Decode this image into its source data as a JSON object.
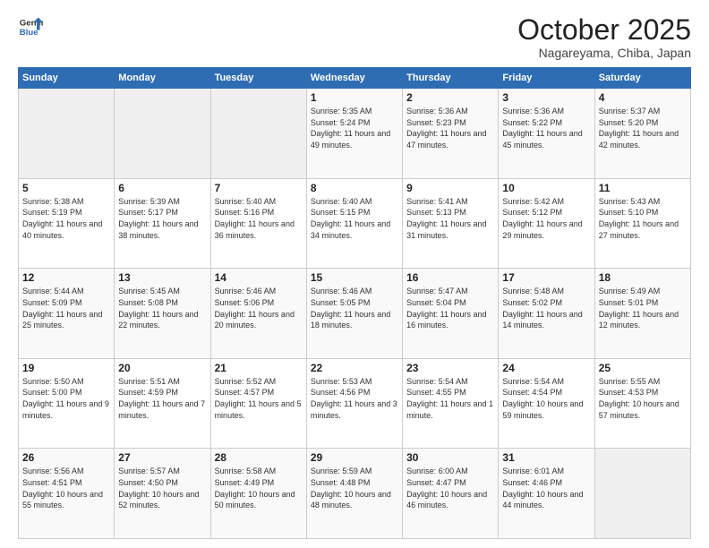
{
  "logo": {
    "line1": "General",
    "line2": "Blue"
  },
  "title": "October 2025",
  "location": "Nagareyama, Chiba, Japan",
  "days_header": [
    "Sunday",
    "Monday",
    "Tuesday",
    "Wednesday",
    "Thursday",
    "Friday",
    "Saturday"
  ],
  "weeks": [
    [
      {
        "day": "",
        "sunrise": "",
        "sunset": "",
        "daylight": ""
      },
      {
        "day": "",
        "sunrise": "",
        "sunset": "",
        "daylight": ""
      },
      {
        "day": "",
        "sunrise": "",
        "sunset": "",
        "daylight": ""
      },
      {
        "day": "1",
        "sunrise": "Sunrise: 5:35 AM",
        "sunset": "Sunset: 5:24 PM",
        "daylight": "Daylight: 11 hours and 49 minutes."
      },
      {
        "day": "2",
        "sunrise": "Sunrise: 5:36 AM",
        "sunset": "Sunset: 5:23 PM",
        "daylight": "Daylight: 11 hours and 47 minutes."
      },
      {
        "day": "3",
        "sunrise": "Sunrise: 5:36 AM",
        "sunset": "Sunset: 5:22 PM",
        "daylight": "Daylight: 11 hours and 45 minutes."
      },
      {
        "day": "4",
        "sunrise": "Sunrise: 5:37 AM",
        "sunset": "Sunset: 5:20 PM",
        "daylight": "Daylight: 11 hours and 42 minutes."
      }
    ],
    [
      {
        "day": "5",
        "sunrise": "Sunrise: 5:38 AM",
        "sunset": "Sunset: 5:19 PM",
        "daylight": "Daylight: 11 hours and 40 minutes."
      },
      {
        "day": "6",
        "sunrise": "Sunrise: 5:39 AM",
        "sunset": "Sunset: 5:17 PM",
        "daylight": "Daylight: 11 hours and 38 minutes."
      },
      {
        "day": "7",
        "sunrise": "Sunrise: 5:40 AM",
        "sunset": "Sunset: 5:16 PM",
        "daylight": "Daylight: 11 hours and 36 minutes."
      },
      {
        "day": "8",
        "sunrise": "Sunrise: 5:40 AM",
        "sunset": "Sunset: 5:15 PM",
        "daylight": "Daylight: 11 hours and 34 minutes."
      },
      {
        "day": "9",
        "sunrise": "Sunrise: 5:41 AM",
        "sunset": "Sunset: 5:13 PM",
        "daylight": "Daylight: 11 hours and 31 minutes."
      },
      {
        "day": "10",
        "sunrise": "Sunrise: 5:42 AM",
        "sunset": "Sunset: 5:12 PM",
        "daylight": "Daylight: 11 hours and 29 minutes."
      },
      {
        "day": "11",
        "sunrise": "Sunrise: 5:43 AM",
        "sunset": "Sunset: 5:10 PM",
        "daylight": "Daylight: 11 hours and 27 minutes."
      }
    ],
    [
      {
        "day": "12",
        "sunrise": "Sunrise: 5:44 AM",
        "sunset": "Sunset: 5:09 PM",
        "daylight": "Daylight: 11 hours and 25 minutes."
      },
      {
        "day": "13",
        "sunrise": "Sunrise: 5:45 AM",
        "sunset": "Sunset: 5:08 PM",
        "daylight": "Daylight: 11 hours and 22 minutes."
      },
      {
        "day": "14",
        "sunrise": "Sunrise: 5:46 AM",
        "sunset": "Sunset: 5:06 PM",
        "daylight": "Daylight: 11 hours and 20 minutes."
      },
      {
        "day": "15",
        "sunrise": "Sunrise: 5:46 AM",
        "sunset": "Sunset: 5:05 PM",
        "daylight": "Daylight: 11 hours and 18 minutes."
      },
      {
        "day": "16",
        "sunrise": "Sunrise: 5:47 AM",
        "sunset": "Sunset: 5:04 PM",
        "daylight": "Daylight: 11 hours and 16 minutes."
      },
      {
        "day": "17",
        "sunrise": "Sunrise: 5:48 AM",
        "sunset": "Sunset: 5:02 PM",
        "daylight": "Daylight: 11 hours and 14 minutes."
      },
      {
        "day": "18",
        "sunrise": "Sunrise: 5:49 AM",
        "sunset": "Sunset: 5:01 PM",
        "daylight": "Daylight: 11 hours and 12 minutes."
      }
    ],
    [
      {
        "day": "19",
        "sunrise": "Sunrise: 5:50 AM",
        "sunset": "Sunset: 5:00 PM",
        "daylight": "Daylight: 11 hours and 9 minutes."
      },
      {
        "day": "20",
        "sunrise": "Sunrise: 5:51 AM",
        "sunset": "Sunset: 4:59 PM",
        "daylight": "Daylight: 11 hours and 7 minutes."
      },
      {
        "day": "21",
        "sunrise": "Sunrise: 5:52 AM",
        "sunset": "Sunset: 4:57 PM",
        "daylight": "Daylight: 11 hours and 5 minutes."
      },
      {
        "day": "22",
        "sunrise": "Sunrise: 5:53 AM",
        "sunset": "Sunset: 4:56 PM",
        "daylight": "Daylight: 11 hours and 3 minutes."
      },
      {
        "day": "23",
        "sunrise": "Sunrise: 5:54 AM",
        "sunset": "Sunset: 4:55 PM",
        "daylight": "Daylight: 11 hours and 1 minute."
      },
      {
        "day": "24",
        "sunrise": "Sunrise: 5:54 AM",
        "sunset": "Sunset: 4:54 PM",
        "daylight": "Daylight: 10 hours and 59 minutes."
      },
      {
        "day": "25",
        "sunrise": "Sunrise: 5:55 AM",
        "sunset": "Sunset: 4:53 PM",
        "daylight": "Daylight: 10 hours and 57 minutes."
      }
    ],
    [
      {
        "day": "26",
        "sunrise": "Sunrise: 5:56 AM",
        "sunset": "Sunset: 4:51 PM",
        "daylight": "Daylight: 10 hours and 55 minutes."
      },
      {
        "day": "27",
        "sunrise": "Sunrise: 5:57 AM",
        "sunset": "Sunset: 4:50 PM",
        "daylight": "Daylight: 10 hours and 52 minutes."
      },
      {
        "day": "28",
        "sunrise": "Sunrise: 5:58 AM",
        "sunset": "Sunset: 4:49 PM",
        "daylight": "Daylight: 10 hours and 50 minutes."
      },
      {
        "day": "29",
        "sunrise": "Sunrise: 5:59 AM",
        "sunset": "Sunset: 4:48 PM",
        "daylight": "Daylight: 10 hours and 48 minutes."
      },
      {
        "day": "30",
        "sunrise": "Sunrise: 6:00 AM",
        "sunset": "Sunset: 4:47 PM",
        "daylight": "Daylight: 10 hours and 46 minutes."
      },
      {
        "day": "31",
        "sunrise": "Sunrise: 6:01 AM",
        "sunset": "Sunset: 4:46 PM",
        "daylight": "Daylight: 10 hours and 44 minutes."
      },
      {
        "day": "",
        "sunrise": "",
        "sunset": "",
        "daylight": ""
      }
    ]
  ]
}
